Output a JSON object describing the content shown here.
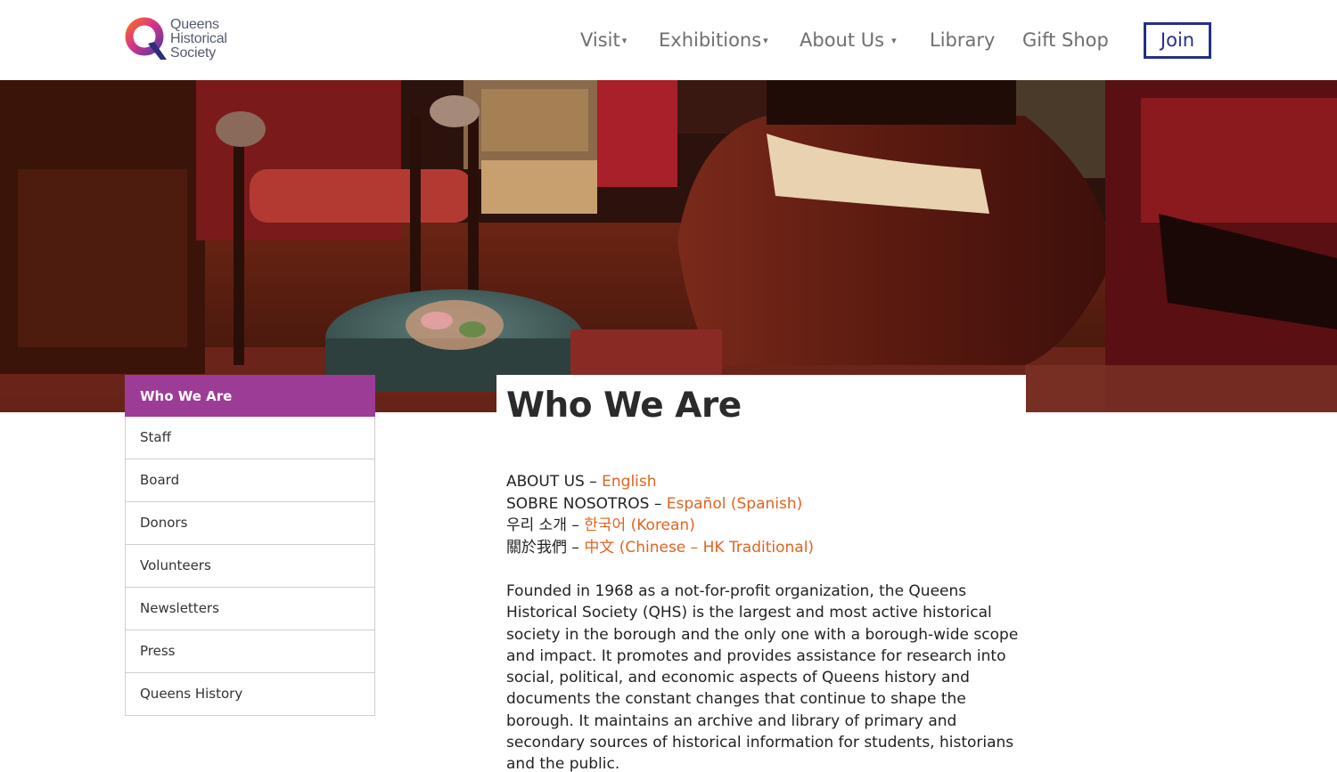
{
  "logo": {
    "line1": "Queens",
    "line2": "Historical",
    "line3": "Society"
  },
  "nav": {
    "visit": "Visit",
    "exhibitions": "Exhibitions",
    "about": "About Us",
    "library": "Library",
    "gift_shop": "Gift Shop",
    "join": "Join"
  },
  "colors": {
    "accent_purple": "#9c3c97",
    "link_orange": "#e0641f",
    "join_navy": "#262f87"
  },
  "sidebar": {
    "items": [
      {
        "label": "Who We Are"
      },
      {
        "label": "Staff"
      },
      {
        "label": "Board"
      },
      {
        "label": "Donors"
      },
      {
        "label": "Volunteers"
      },
      {
        "label": "Newsletters"
      },
      {
        "label": "Press"
      },
      {
        "label": "Queens History"
      }
    ]
  },
  "main": {
    "title": "Who We Are",
    "languages": [
      {
        "prefix": "ABOUT US – ",
        "link": "English"
      },
      {
        "prefix": "SOBRE NOSOTROS – ",
        "link": "Español (Spanish)"
      },
      {
        "prefix": "우리 소개 – ",
        "link": "한국어 (Korean)"
      },
      {
        "prefix": "關於我們 – ",
        "link": "中文 (Chinese – HK Traditional)"
      }
    ],
    "body": "Founded in 1968 as a not-for-profit organization, the Queens Historical Society (QHS) is the largest and most active historical society in the borough and the only one with a borough-wide scope and impact. It promotes and provides assistance for research into social, political, and economic aspects of Queens history and documents the constant changes that continue to shape the borough. It maintains an archive and library of primary and secondary sources of historical information for students, historians and the public."
  }
}
